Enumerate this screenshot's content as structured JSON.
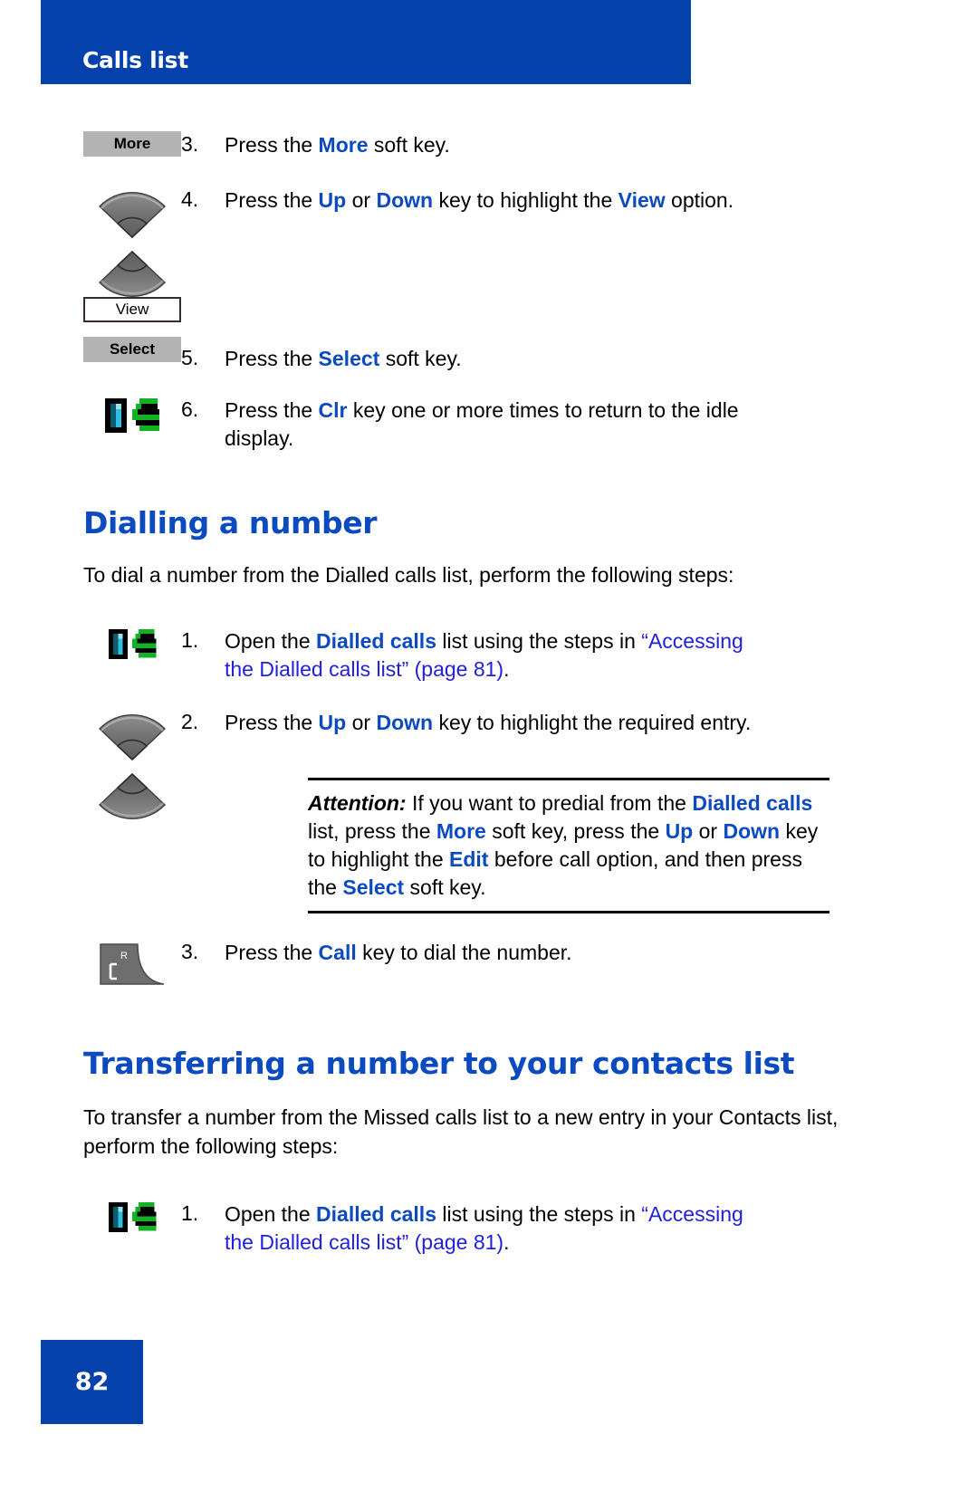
{
  "header": {
    "title": "Calls list",
    "banner_color": "#0541ab"
  },
  "footer": {
    "page_number": "82",
    "banner_color": "#0541ab"
  },
  "colors": {
    "heading_blue": "#0b4bbf",
    "keyword_blue": "#0b4bbf",
    "xref_blue": "#2020dd",
    "softkey_gray": "#b3b3b3"
  },
  "top_steps": [
    {
      "number": "3.",
      "icon": "softkey-more",
      "icon_label": "More",
      "text_parts": [
        {
          "t": "Press the ",
          "s": "plain"
        },
        {
          "t": "More",
          "s": "kw"
        },
        {
          "t": " soft key.",
          "s": "plain"
        }
      ]
    },
    {
      "number": "4.",
      "icon": "nav-up-down-keys",
      "icon_label": "",
      "text_parts": [
        {
          "t": "Press the ",
          "s": "plain"
        },
        {
          "t": "Up",
          "s": "kw"
        },
        {
          "t": " or ",
          "s": "plain"
        },
        {
          "t": "Down",
          "s": "kw"
        },
        {
          "t": " key to highlight the ",
          "s": "plain"
        },
        {
          "t": "View",
          "s": "kw"
        },
        {
          "t": " option.",
          "s": "plain"
        }
      ]
    },
    {
      "number": "5.",
      "icon": "softkey-select",
      "icon_label": "Select",
      "outline_label": "View",
      "text_parts": [
        {
          "t": "Press the ",
          "s": "plain"
        },
        {
          "t": "Select",
          "s": "kw"
        },
        {
          "t": " soft key.",
          "s": "plain"
        }
      ]
    },
    {
      "number": "6.",
      "icon": "clr-key-icon",
      "icon_label": "",
      "text_parts": [
        {
          "t": "Press the ",
          "s": "plain"
        },
        {
          "t": "Clr",
          "s": "kw"
        },
        {
          "t": " key one or more times to return to the idle display.",
          "s": "plain"
        }
      ]
    }
  ],
  "section1": {
    "heading": "Dialling a number",
    "intro": "To dial a number from the Dialled calls list, perform the following steps:",
    "steps": [
      {
        "number": "1.",
        "icon": "clr-key-icon",
        "text_parts": [
          {
            "t": "Open the ",
            "s": "plain"
          },
          {
            "t": "Dialled calls",
            "s": "kw"
          },
          {
            "t": " list using the steps in ",
            "s": "plain"
          },
          {
            "t": "“Accessing the Dialled calls list” (page 81)",
            "s": "xref"
          },
          {
            "t": ".",
            "s": "plain"
          }
        ]
      },
      {
        "number": "2.",
        "icon": "nav-up-down-keys",
        "text_parts": [
          {
            "t": "Press the ",
            "s": "plain"
          },
          {
            "t": "Up",
            "s": "kw"
          },
          {
            "t": " or ",
            "s": "plain"
          },
          {
            "t": "Down",
            "s": "kw"
          },
          {
            "t": " key to highlight the required entry.",
            "s": "plain"
          }
        ]
      },
      {
        "number": "3.",
        "icon": "call-key-icon",
        "text_parts": [
          {
            "t": "Press the ",
            "s": "plain"
          },
          {
            "t": "Call",
            "s": "kw"
          },
          {
            "t": " key to dial the number.",
            "s": "plain"
          }
        ]
      }
    ],
    "attention": {
      "label": "Attention:",
      "parts": [
        {
          "t": " If you want to predial from the ",
          "s": "plain"
        },
        {
          "t": "Dialled calls",
          "s": "kw"
        },
        {
          "t": " list, press the ",
          "s": "plain"
        },
        {
          "t": "More",
          "s": "kw"
        },
        {
          "t": " soft key, press the ",
          "s": "plain"
        },
        {
          "t": "Up",
          "s": "kw"
        },
        {
          "t": " or ",
          "s": "plain"
        },
        {
          "t": "Down",
          "s": "kw"
        },
        {
          "t": " key to highlight the ",
          "s": "plain"
        },
        {
          "t": "Edit",
          "s": "kw"
        },
        {
          "t": " before call option, and then press the ",
          "s": "plain"
        },
        {
          "t": "Select",
          "s": "kw"
        },
        {
          "t": " soft key.",
          "s": "plain"
        }
      ]
    }
  },
  "section2": {
    "heading": "Transferring a number to your contacts list",
    "intro": "To transfer a number from the Missed calls list to a new entry in your Contacts list, perform the following steps:",
    "steps": [
      {
        "number": "1.",
        "icon": "clr-key-icon",
        "text_parts": [
          {
            "t": "Open the ",
            "s": "plain"
          },
          {
            "t": "Dialled calls",
            "s": "kw"
          },
          {
            "t": " list using the steps in ",
            "s": "plain"
          },
          {
            "t": "“Accessing the Dialled calls list” (page 81)",
            "s": "xref"
          },
          {
            "t": ".",
            "s": "plain"
          }
        ]
      }
    ]
  },
  "icon_names": {
    "softkey": "softkey-button-icon",
    "nav": "navigation-up-down-key-icon",
    "clr": "clr-key-icon",
    "call": "call-key-icon"
  }
}
